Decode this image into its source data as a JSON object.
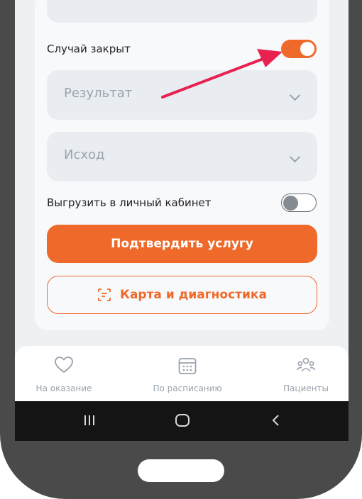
{
  "form": {
    "case_closed_label": "Случай закрыт",
    "case_closed_on": true,
    "result_placeholder": "Результат",
    "outcome_placeholder": "Исход",
    "export_label": "Выгрузить в личный кабинет",
    "export_on": false,
    "confirm_button": "Подтвердить услугу",
    "card_button": "Карта и диагностика"
  },
  "tabbar": {
    "items": [
      {
        "label": "На оказание",
        "icon": "heart-icon"
      },
      {
        "label": "По расписанию",
        "icon": "calendar-icon"
      },
      {
        "label": "Пациенты",
        "icon": "patients-icon"
      }
    ]
  },
  "system_nav": {
    "items": [
      "recent-apps-icon",
      "home-icon",
      "back-icon"
    ]
  },
  "colors": {
    "accent": "#ef6a2a",
    "annotation_arrow": "#e8214f"
  }
}
